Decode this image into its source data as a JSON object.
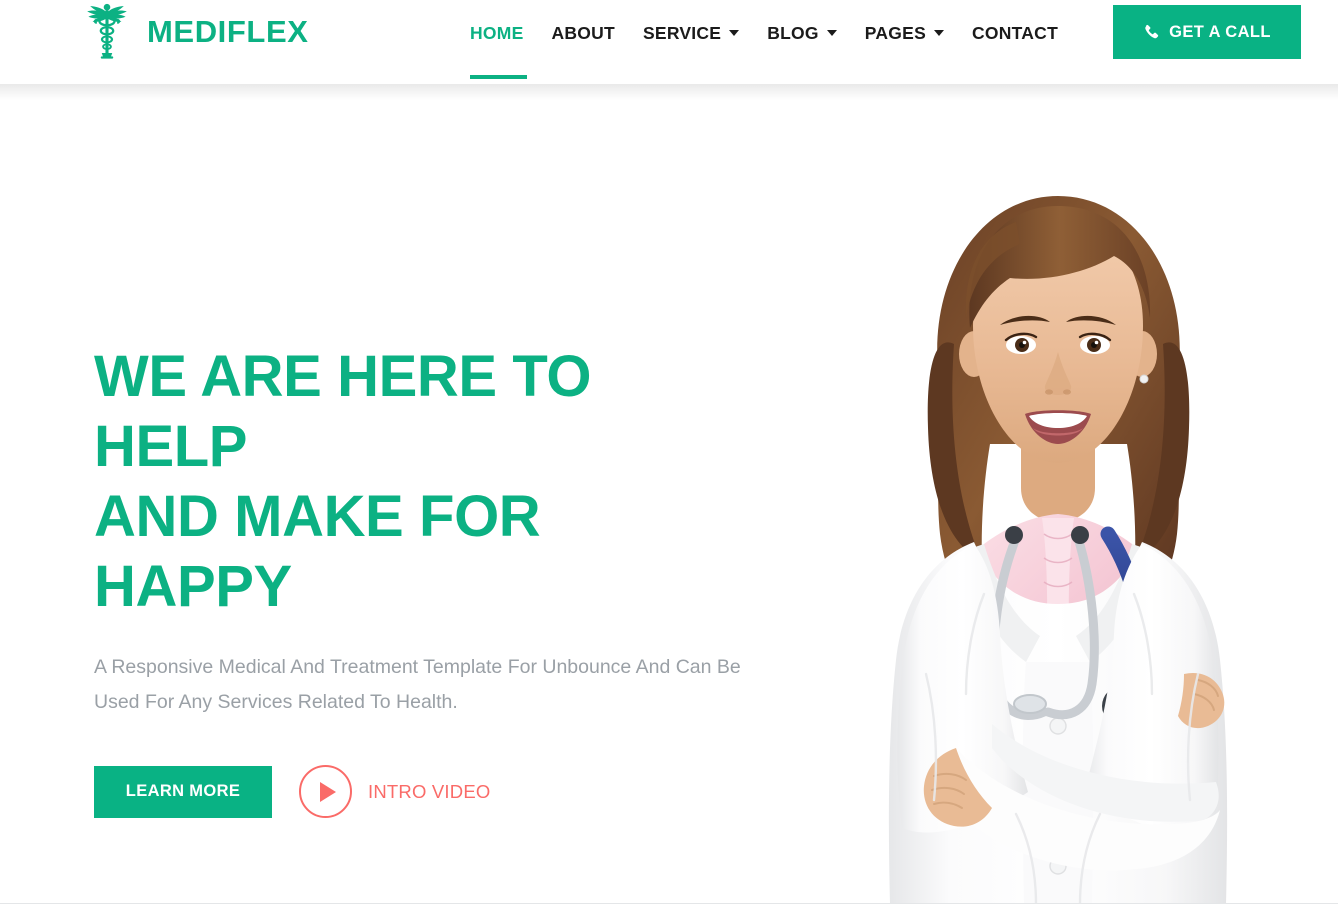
{
  "brand": {
    "name": "MEDIFLEX",
    "logo_icon": "caduceus-icon",
    "color": "#0cb183"
  },
  "nav": {
    "items": [
      {
        "label": "HOME",
        "active": true,
        "has_dropdown": false
      },
      {
        "label": "ABOUT",
        "active": false,
        "has_dropdown": false
      },
      {
        "label": "SERVICE",
        "active": false,
        "has_dropdown": true
      },
      {
        "label": "BLOG",
        "active": false,
        "has_dropdown": true
      },
      {
        "label": "PAGES",
        "active": false,
        "has_dropdown": true
      },
      {
        "label": "CONTACT",
        "active": false,
        "has_dropdown": false
      }
    ],
    "active_color": "#0cb183",
    "inactive_color": "#1b1b1b"
  },
  "header_cta": {
    "label": "GET A CALL",
    "icon": "phone-icon",
    "background": "#09b284",
    "text_color": "#ffffff"
  },
  "hero": {
    "title_line_1": "WE ARE HERE TO HELP",
    "title_line_2": "AND MAKE FOR HAPPY",
    "title": "WE ARE HERE TO HELP AND MAKE FOR HAPPY",
    "subtitle": "A Responsive Medical And Treatment Template For Unbounce And Can Be Used For Any Services Related To Health.",
    "title_color": "#0cb183",
    "subtitle_color": "#9aa0a6",
    "primary_button": {
      "label": "LEARN MORE",
      "background": "#09b284",
      "text_color": "#ffffff"
    },
    "video_link": {
      "label": "INTRO VIDEO",
      "icon": "play-icon",
      "color": "#fa6b68"
    },
    "image": {
      "alt": "smiling female doctor with stethoscope, arms crossed",
      "name": "doctor-photo"
    }
  }
}
